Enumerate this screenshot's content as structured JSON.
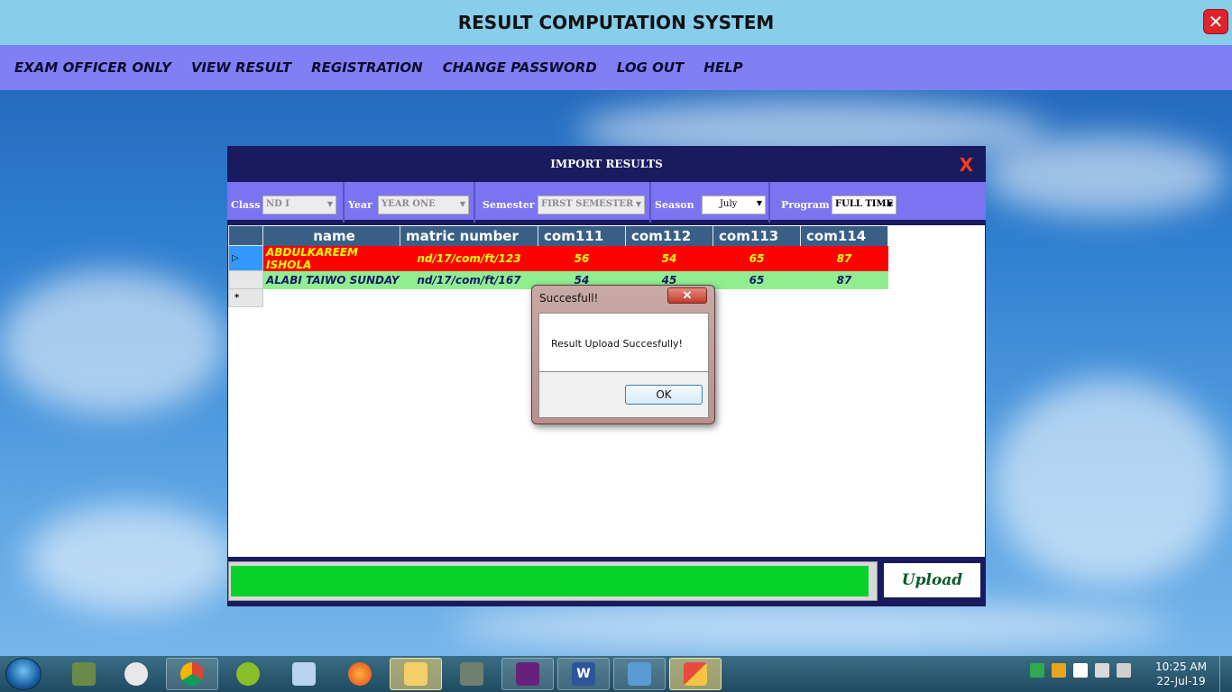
{
  "app": {
    "title": "RESULT COMPUTATION SYSTEM",
    "close_icon": "close-icon"
  },
  "menu": {
    "items": [
      "EXAM OFFICER ONLY",
      "VIEW RESULT",
      "REGISTRATION",
      "CHANGE PASSWORD",
      "LOG OUT",
      "HELP"
    ]
  },
  "import_dialog": {
    "title": "IMPORT RESULTS",
    "close_label": "X",
    "filters": {
      "class_label": "Class",
      "class_value": "ND I",
      "year_label": "Year",
      "year_value": "YEAR ONE",
      "semester_label": "Semester",
      "semester_value": "FIRST SEMESTER",
      "season_label": "Season",
      "season_value": "July",
      "program_label": "Program",
      "program_value": "FULL TIME"
    },
    "grid": {
      "columns": [
        "name",
        "matric number",
        "com111",
        "com112",
        "com113",
        "com114"
      ],
      "rows": [
        {
          "name": "ABDULKAREEM ISHOLA",
          "matric": "nd/17/com/ft/123",
          "com111": "56",
          "com112": "54",
          "com113": "65",
          "com114": "87"
        },
        {
          "name": "ALABI TAIWO SUNDAY",
          "matric": "nd/17/com/ft/167",
          "com111": "54",
          "com112": "45",
          "com113": "65",
          "com114": "87"
        }
      ],
      "new_row_marker": "*",
      "current_row_marker": "▷"
    },
    "progress_fraction": 0.99,
    "upload_label": "Upload"
  },
  "message_box": {
    "title": "Succesfull!",
    "close_label": "✕",
    "message": "Result Upload Succesfully!",
    "ok_label": "OK"
  },
  "taskbar": {
    "time": "10:25 AM",
    "date": "22-Jul-19",
    "word_label": "W"
  },
  "colors": {
    "title_bg": "#87ceeb",
    "menu_bg": "#8080f4",
    "dialog_bg": "#1a1a5e",
    "row1_bg": "#ff0000",
    "row1_fg": "#ffff00",
    "row2_bg": "#90ee90",
    "progress_fill": "#06d32a"
  }
}
